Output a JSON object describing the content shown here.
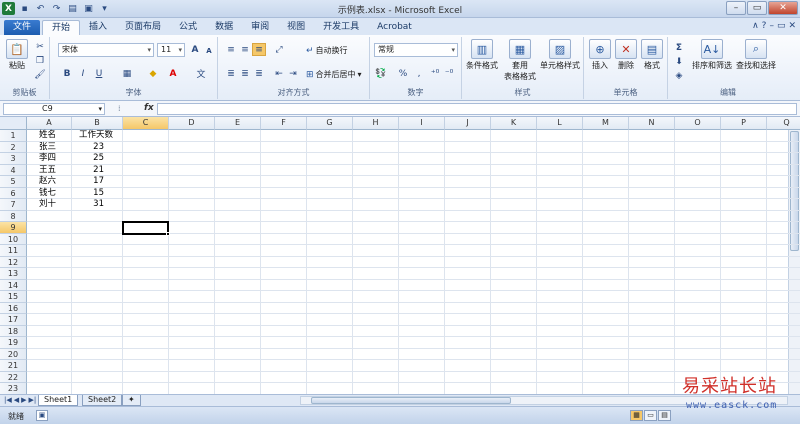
{
  "window": {
    "title": "示例表.xlsx - Microsoft Excel",
    "app_icon": "X",
    "controls": {
      "minimize": "–",
      "maximize": "▭",
      "close": "✕"
    }
  },
  "ribbon_tabs": {
    "file": "文件",
    "tabs": [
      "开始",
      "插入",
      "页面布局",
      "公式",
      "数据",
      "审阅",
      "视图",
      "开发工具",
      "Acrobat"
    ],
    "active_index": 0
  },
  "ribbon": {
    "clipboard": {
      "paste": "粘贴",
      "label": "剪贴板"
    },
    "font": {
      "name": "宋体",
      "size": "11",
      "bold": "B",
      "italic": "I",
      "underline": "U",
      "label": "字体",
      "grow": "A",
      "shrink": "A"
    },
    "alignment": {
      "wrap": "自动换行",
      "merge": "合并后居中",
      "label": "对齐方式"
    },
    "number": {
      "format": "常规",
      "percent": "%",
      "comma": ",",
      "label": "数字"
    },
    "styles": {
      "conditional": "条件格式",
      "table1": "套用",
      "table2": "表格格式",
      "cell_styles": "单元格样式",
      "label": "样式"
    },
    "cells": {
      "insert": "插入",
      "delete": "删除",
      "format": "格式",
      "label": "单元格"
    },
    "editing": {
      "sort": "排序和筛选",
      "find": "查找和选择",
      "sum": "Σ",
      "label": "编辑"
    }
  },
  "formula_bar": {
    "name_box": "C9",
    "fx": "fx",
    "value": ""
  },
  "columns": [
    "A",
    "B",
    "C",
    "D",
    "E",
    "F",
    "G",
    "H",
    "I",
    "J",
    "K",
    "L",
    "M",
    "N",
    "O",
    "P",
    "Q"
  ],
  "rows": [
    "1",
    "2",
    "3",
    "4",
    "5",
    "6",
    "7",
    "8",
    "9",
    "10",
    "11",
    "12",
    "13",
    "14",
    "15",
    "16",
    "17",
    "18",
    "19",
    "20",
    "21",
    "22",
    "23"
  ],
  "selected_cell": "C9",
  "cells": {
    "A1": "姓名",
    "B1": "工作天数",
    "A2": "张三",
    "B2": "23",
    "A3": "李四",
    "B3": "25",
    "A4": "王五",
    "B4": "21",
    "A5": "赵六",
    "B5": "17",
    "A6": "钱七",
    "B6": "15",
    "A7": "刘十",
    "B7": "31"
  },
  "sheets": [
    "Sheet1",
    "Sheet2"
  ],
  "active_sheet": 0,
  "status": {
    "mode": "就绪"
  },
  "watermark": {
    "cn": "易采站长站",
    "url": "www.easck.com"
  }
}
